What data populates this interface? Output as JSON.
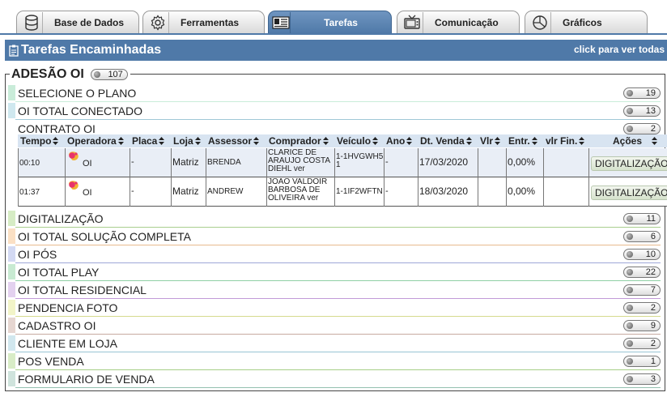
{
  "tabs": [
    {
      "label": "Base de Dados",
      "icon": "database-icon"
    },
    {
      "label": "Ferramentas",
      "icon": "gear-icon"
    },
    {
      "label": "Tarefas",
      "icon": "task-list-icon",
      "active": true
    },
    {
      "label": "Comunicação",
      "icon": "tv-icon"
    },
    {
      "label": "Gráficos",
      "icon": "pie-chart-icon"
    }
  ],
  "header": {
    "title": "Tarefas Encaminhadas",
    "link": "click para ver todas",
    "icon": "clipboard-icon"
  },
  "group": {
    "title": "ADESÃO OI",
    "count": "107"
  },
  "categories": [
    {
      "label": "SELECIONE O PLANO",
      "count": "19",
      "color": "#c9ecd9"
    },
    {
      "label": "OI TOTAL CONECTADO",
      "count": "13",
      "color": "#cfe8ef"
    },
    {
      "label": "CONTRATO OI",
      "count": "2",
      "color": "#ffffff"
    },
    {
      "label": "DIGITALIZAÇÃO",
      "count": "11",
      "color": "#d6ecc4"
    },
    {
      "label": "OI TOTAL SOLUÇÃO COMPLETA",
      "count": "6",
      "color": "#fbe0c4"
    },
    {
      "label": "OI PÓS",
      "count": "10",
      "color": "#d3d9f3"
    },
    {
      "label": "OI TOTAL PLAY",
      "count": "22",
      "color": "#c8ead2"
    },
    {
      "label": "OI TOTAL RESIDENCIAL",
      "count": "7",
      "color": "#e3d1ef"
    },
    {
      "label": "PENDENCIA FOTO",
      "count": "2",
      "color": "#f2f4c8"
    },
    {
      "label": "CADASTRO OI",
      "count": "9",
      "color": "#e6d6d1"
    },
    {
      "label": "CLIENTE EM LOJA",
      "count": "2",
      "color": "#d1e7ee"
    },
    {
      "label": "POS VENDA",
      "count": "1",
      "color": "#d8ecc6"
    },
    {
      "label": "FORMULARIO DE VENDA",
      "count": "3",
      "color": "#cfe3dc"
    }
  ],
  "table": {
    "columns": [
      "Tempo",
      "Operadora",
      "Placa",
      "Loja",
      "Assessor",
      "Comprador",
      "Veículo",
      "Ano",
      "Dt. Venda",
      "Vlr",
      "Entr.",
      "vlr Fin.",
      "Ações"
    ],
    "rows": [
      {
        "tempo": "00:10",
        "operadora": "OI",
        "placa": "-",
        "loja": "Matriz",
        "assessor": "BRENDA",
        "comprador": "CLARICE DE ARAUJO COSTA DIEHL ver",
        "veiculo": "1-1HVGWH51",
        "ano": "-",
        "dt_venda": "17/03/2020",
        "vlr": "",
        "entr": "0,00%",
        "vlr_fin": "",
        "acao": "DIGITALIZAÇÃO"
      },
      {
        "tempo": "01:37",
        "operadora": "OI",
        "placa": "-",
        "loja": "Matriz",
        "assessor": "ANDREW",
        "comprador": "JOAO VALDOIR BARBOSA DE OLIVEIRA ver",
        "veiculo": "1-1IF2WFTN",
        "ano": "-",
        "dt_venda": "18/03/2020",
        "vlr": "",
        "entr": "0,00%",
        "vlr_fin": "",
        "acao": "DIGITALIZAÇÃO"
      }
    ]
  },
  "colors": {
    "accent": "#4f79a8",
    "header_row": "#d8e4f1",
    "row_highlight": "#e9eef6"
  }
}
